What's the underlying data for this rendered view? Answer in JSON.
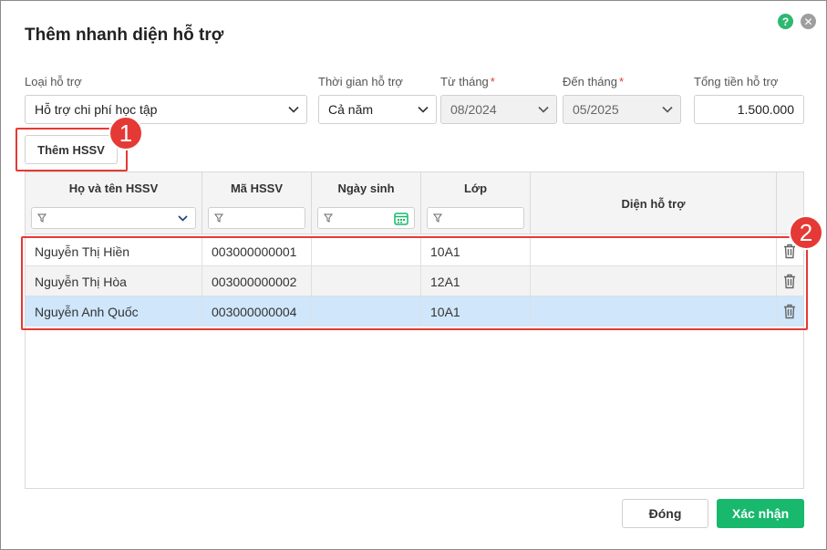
{
  "dialog": {
    "title": "Thêm nhanh diện hỗ trợ",
    "help_icon": "?",
    "close_icon": "✕"
  },
  "form": {
    "support_type": {
      "label": "Loại hỗ trợ",
      "value": "Hỗ trợ chi phí học tập"
    },
    "support_time": {
      "label": "Thời gian hỗ trợ",
      "value": "Cả năm"
    },
    "from_month": {
      "label": "Từ tháng",
      "required_mark": "*",
      "value": "08/2024"
    },
    "to_month": {
      "label": "Đến tháng",
      "required_mark": "*",
      "value": "05/2025"
    },
    "total_amount": {
      "label": "Tổng tiền hỗ trợ",
      "value": "1.500.000"
    }
  },
  "toolbar": {
    "add_student_label": "Thêm HSSV"
  },
  "markers": {
    "one": "1",
    "two": "2"
  },
  "grid": {
    "columns": [
      "Họ và tên HSSV",
      "Mã HSSV",
      "Ngày sinh",
      "Lớp",
      "Diện hỗ trợ"
    ],
    "rows": [
      {
        "name": "Nguyễn Thị Hiền",
        "code": "003000000001",
        "dob": "",
        "class": "10A1",
        "support": ""
      },
      {
        "name": "Nguyễn Thị Hòa",
        "code": "003000000002",
        "dob": "",
        "class": "12A1",
        "support": ""
      },
      {
        "name": "Nguyễn Anh Quốc",
        "code": "003000000004",
        "dob": "",
        "class": "10A1",
        "support": ""
      }
    ]
  },
  "footer": {
    "close_label": "Đóng",
    "confirm_label": "Xác nhận"
  },
  "colors": {
    "accent": "#18b86d",
    "marker": "#e53935",
    "selected_row": "#cfe6fb"
  }
}
